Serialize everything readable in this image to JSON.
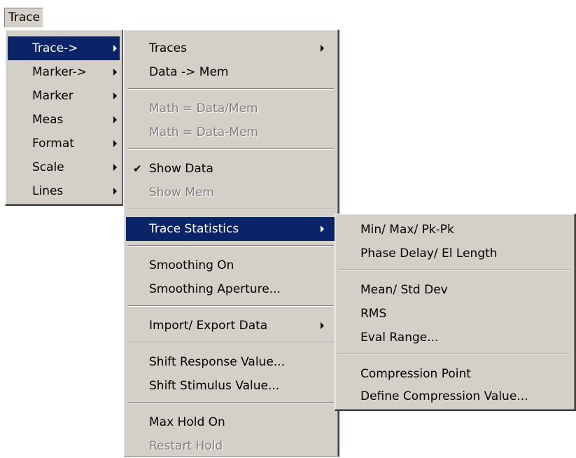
{
  "menubar": {
    "trace_label": "Trace"
  },
  "menu_main": {
    "items": [
      "Trace->",
      "Marker->",
      "Marker",
      "Meas",
      "Format",
      "Scale",
      "Lines"
    ]
  },
  "menu_trace": {
    "traces": "Traces",
    "data_to_mem": "Data -> Mem",
    "math_div": "Math = Data/Mem",
    "math_sub": "Math = Data-Mem",
    "show_data": "Show Data",
    "show_data_check": "✔",
    "show_mem": "Show Mem",
    "trace_statistics": "Trace Statistics",
    "smoothing_on": "Smoothing On",
    "smoothing_aperture": "Smoothing Aperture...",
    "import_export": "Import/ Export Data",
    "shift_response": "Shift Response Value...",
    "shift_stimulus": "Shift Stimulus Value...",
    "max_hold_on": "Max Hold On",
    "restart_hold": "Restart Hold"
  },
  "menu_stats": {
    "min_max": "Min/ Max/ Pk-Pk",
    "phase_delay": "Phase Delay/ El Length",
    "mean_std": "Mean/ Std Dev",
    "rms": "RMS",
    "eval_range": "Eval Range...",
    "compression_point": "Compression Point",
    "define_compression": "Define Compression Value..."
  }
}
